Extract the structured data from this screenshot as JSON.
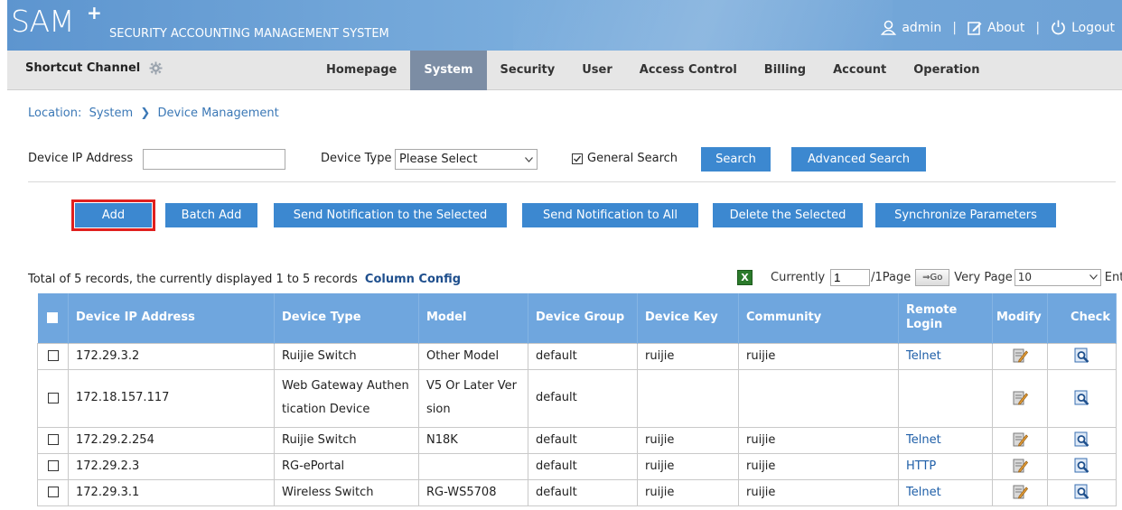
{
  "header": {
    "logo_main": "SAM",
    "logo_plus": "+",
    "logo_sub": "SECURITY ACCOUNTING MANAGEMENT SYSTEM",
    "user_label": "admin",
    "about_label": "About",
    "logout_label": "Logout",
    "separator": "|"
  },
  "nav": {
    "shortcut_label": "Shortcut Channel",
    "items": [
      {
        "label": "Homepage"
      },
      {
        "label": "System"
      },
      {
        "label": "Security"
      },
      {
        "label": "User"
      },
      {
        "label": "Access Control"
      },
      {
        "label": "Billing"
      },
      {
        "label": "Account"
      },
      {
        "label": "Operation"
      }
    ],
    "active": "System"
  },
  "breadcrumb": "Location:  System  ❯  Device Management",
  "search": {
    "ip_label": "Device IP Address",
    "ip_value": "",
    "type_label": "Device Type",
    "type_value": "Please Select",
    "general_label": "General Search",
    "general_checked": true,
    "search_button": "Search",
    "advanced_button": "Advanced Search"
  },
  "actions": {
    "add": "Add",
    "batch_add": "Batch Add",
    "notify_selected": "Send Notification to the Selected",
    "notify_all": "Send Notification to All",
    "delete_selected": "Delete the Selected",
    "sync_params": "Synchronize Parameters"
  },
  "summary": {
    "text": "Total of 5 records, the currently displayed 1 to 5 records",
    "column_config": "Column Config"
  },
  "pager": {
    "excel_icon": "excel-icon",
    "currently_label": "Currently",
    "current_page": "1",
    "total_pages": "/1Page",
    "go_label": "⇒Go",
    "very_page_label": "Very Page",
    "page_size": "10",
    "entry_label": "Entry"
  },
  "table": {
    "headers": {
      "ip": "Device IP Address",
      "type": "Device Type",
      "model": "Model",
      "group": "Device Group",
      "key": "Device Key",
      "community": "Community",
      "remote": "Remote Login",
      "modify": "Modify",
      "check": "Check"
    },
    "rows": [
      {
        "ip": "172.29.3.2",
        "type": "Ruijie Switch",
        "model": "Other Model",
        "group": "default",
        "key": "ruijie",
        "community": "ruijie",
        "remote": "Telnet"
      },
      {
        "ip": "172.18.157.117",
        "type": "Web Gateway Authentication Device",
        "model": "V5 Or Later Version",
        "group": "default",
        "key": "",
        "community": "",
        "remote": ""
      },
      {
        "ip": "172.29.2.254",
        "type": "Ruijie Switch",
        "model": "N18K",
        "group": "default",
        "key": "ruijie",
        "community": "ruijie",
        "remote": "Telnet"
      },
      {
        "ip": "172.29.2.3",
        "type": "RG-ePortal",
        "model": "",
        "group": "default",
        "key": "ruijie",
        "community": "ruijie",
        "remote": "HTTP"
      },
      {
        "ip": "172.29.3.1",
        "type": "Wireless Switch",
        "model": "RG-WS5708",
        "group": "default",
        "key": "ruijie",
        "community": "ruijie",
        "remote": "Telnet"
      }
    ]
  },
  "colors": {
    "header_blue": "#6ea2d6",
    "nav_active": "#7c8da4",
    "button_blue": "#3c88d0",
    "table_header": "#6fa6de",
    "highlight_red": "#e0201e",
    "link_blue": "#1f5fa8"
  }
}
